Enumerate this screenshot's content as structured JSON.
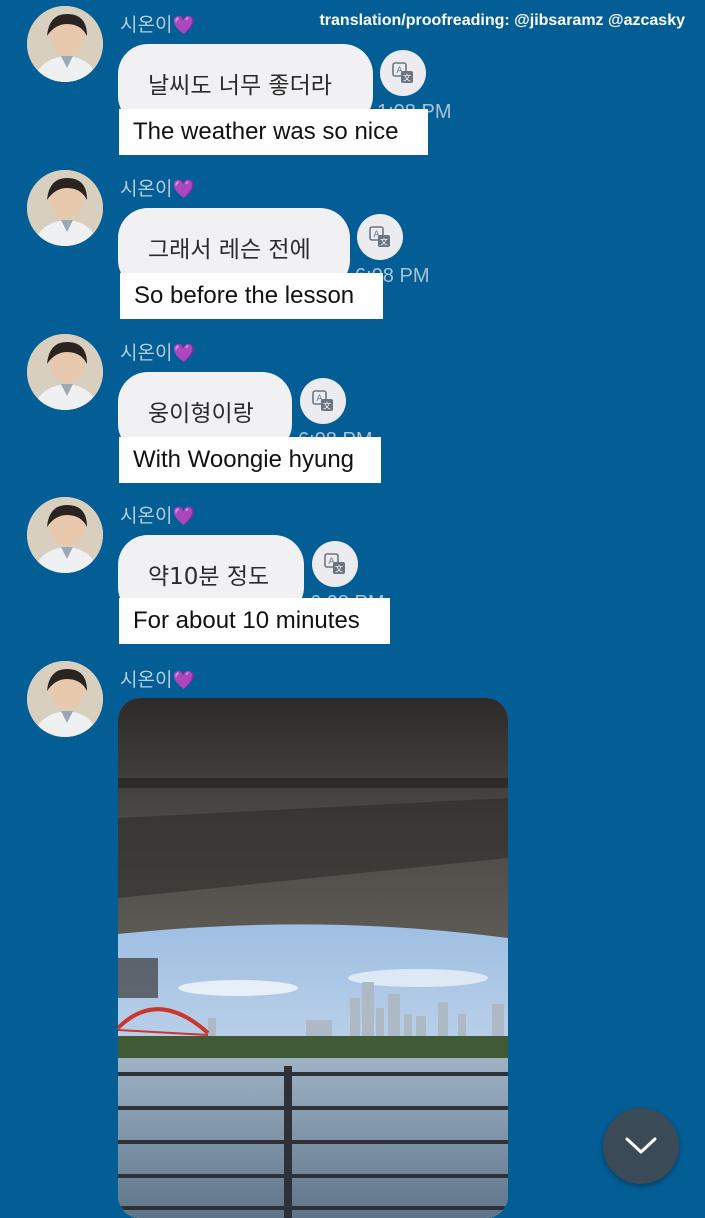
{
  "credit": "translation/proofreading: @jibsaramz @azcasky",
  "sender_name": "시온이",
  "sender_emoji": "💜",
  "messages": [
    {
      "text": "날씨도 너무 좋더라",
      "time": "1:08 PM",
      "translation": "The weather was so nice"
    },
    {
      "text": "그래서 레슨 전에",
      "time": "6:08 PM",
      "translation": "So before the lesson"
    },
    {
      "text": "웅이형이랑",
      "time": "6:08 PM",
      "translation": "With Woongie hyung"
    },
    {
      "text": "약10분 정도",
      "time": "6:08 PM",
      "translation": "For about 10 minutes"
    }
  ],
  "photo_message": {
    "sender_name": "시온이",
    "sender_emoji": "💜"
  },
  "icons": {
    "translate": "translate-icon",
    "scroll_down": "chevron-down-icon"
  },
  "colors": {
    "background": "#045e96",
    "bubble": "#f1f0f3",
    "caption_bg": "#ffffff",
    "heart": "#a64ddc"
  }
}
